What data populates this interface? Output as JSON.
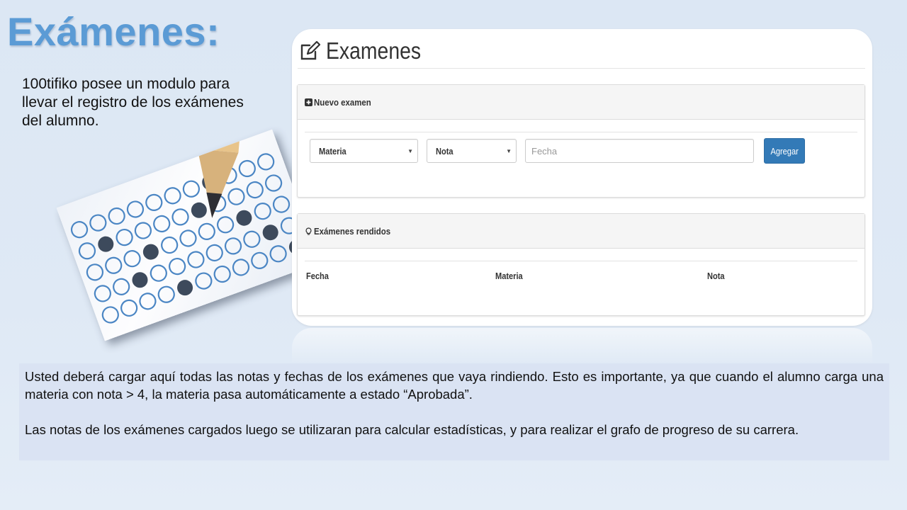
{
  "slide": {
    "title": "Exámenes:",
    "intro": "100tifiko posee un modulo para llevar el registro de los exámenes del alumno.",
    "photo_icon": "pencil-answer-sheet-photo",
    "notes": [
      "Usted deberá cargar aquí todas las notas y fechas de los exámenes que vaya rindiendo. Esto es importante, ya que cuando el alumno carga una materia con nota > 4, la materia pasa automáticamente a estado “Aprobada”.",
      "Las notas de los exámenes cargados luego se utilizaran para calcular estadísticas, y para realizar el grafo de progreso de su carrera."
    ]
  },
  "app": {
    "title": "Examenes",
    "title_icon": "edit-icon",
    "new_exam": {
      "heading": "Nuevo examen",
      "heading_icon": "plus-square-icon",
      "materia_select": "Materia",
      "nota_select": "Nota",
      "fecha_placeholder": "Fecha",
      "add_button": "Agregar"
    },
    "taken_exams": {
      "heading": "Exámenes rendidos",
      "heading_icon": "lightbulb-icon",
      "columns": [
        "Fecha",
        "Materia",
        "Nota"
      ]
    }
  },
  "colors": {
    "title_blue": "#5b9bd5",
    "button_blue": "#337ab7",
    "note_bg": "#dae3f3"
  }
}
